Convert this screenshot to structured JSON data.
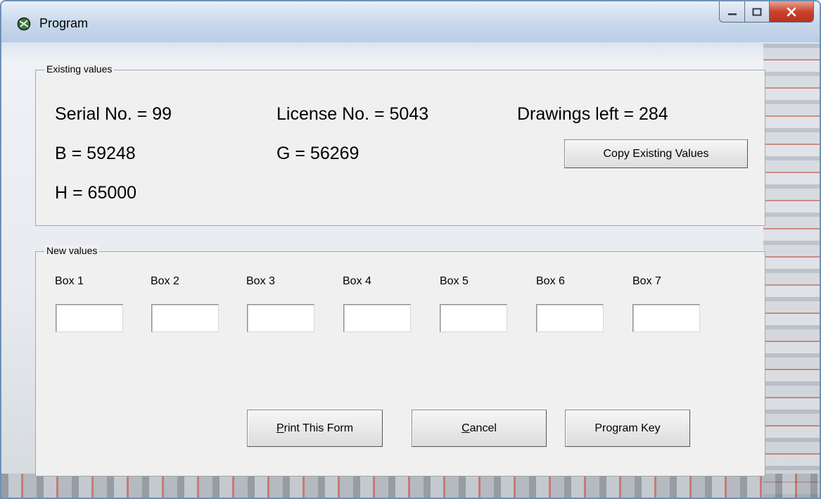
{
  "window": {
    "title": "Program",
    "icon": "globe-circle-icon"
  },
  "existing": {
    "group_label": "Existing values",
    "serial": "Serial No. = 99",
    "license": "License No. = 5043",
    "drawings": "Drawings left = 284",
    "b": "B = 59248",
    "g": "G = 56269",
    "h": "H = 65000",
    "copy_button": "Copy Existing Values"
  },
  "new_values": {
    "group_label": "New values",
    "boxes": [
      {
        "label": "Box 1",
        "value": ""
      },
      {
        "label": "Box 2",
        "value": ""
      },
      {
        "label": "Box 3",
        "value": ""
      },
      {
        "label": "Box 4",
        "value": ""
      },
      {
        "label": "Box 5",
        "value": ""
      },
      {
        "label": "Box 6",
        "value": ""
      },
      {
        "label": "Box 7",
        "value": ""
      }
    ]
  },
  "buttons": {
    "print_prefix": "P",
    "print_rest": "rint This Form",
    "cancel_prefix": "C",
    "cancel_rest": "ancel",
    "program_key": "Program Key"
  },
  "colors": {
    "close_button": "#c9432c",
    "frame": "#6f8fb8"
  }
}
